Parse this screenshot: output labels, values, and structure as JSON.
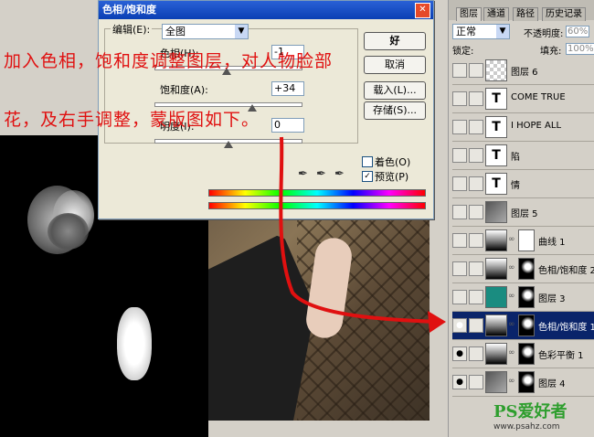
{
  "dialog": {
    "title": "色相/饱和度",
    "edit_label": "编辑(E):",
    "edit_value": "全图",
    "hue_label": "色相(H):",
    "hue_value": "-1",
    "saturation_label": "饱和度(A):",
    "saturation_value": "+34",
    "lightness_label": "明度(I):",
    "lightness_value": "0",
    "btn_ok": "好",
    "btn_cancel": "取消",
    "btn_load": "载入(L)...",
    "btn_save": "存储(S)...",
    "colorize_label": "着色(O)",
    "colorize_checked": false,
    "preview_label": "预览(P)",
    "preview_checked": true,
    "close_glyph": "✕"
  },
  "overlay": {
    "line1": "加入色相，饱和度调整图层，对人物脸部",
    "line2": "花，及右手调整，蒙版图如下。"
  },
  "panel": {
    "tabs": [
      "图层",
      "通道",
      "路径",
      "历史记录"
    ],
    "blend_mode": "正常",
    "opacity_label": "不透明度:",
    "opacity_value": "60%",
    "lock_label": "锁定:",
    "fill_label": "填充:",
    "fill_value": "100%",
    "layers": [
      {
        "name": "图层 6",
        "type": "pixel",
        "visible": false
      },
      {
        "name": "COME TRUE",
        "type": "text",
        "visible": false
      },
      {
        "name": "I HOPE ALL",
        "type": "text",
        "visible": false
      },
      {
        "name": "陷",
        "type": "text",
        "visible": false
      },
      {
        "name": "情",
        "type": "text",
        "visible": false
      },
      {
        "name": "图层 5",
        "type": "pixel",
        "visible": false
      },
      {
        "name": "曲线 1",
        "type": "adjust",
        "visible": false
      },
      {
        "name": "色相/饱和度 2",
        "type": "adjust",
        "visible": false
      },
      {
        "name": "图层 3",
        "type": "pixel",
        "visible": false
      },
      {
        "name": "色相/饱和度 1",
        "type": "adjust",
        "visible": true,
        "selected": true
      },
      {
        "name": "色彩平衡 1",
        "type": "adjust",
        "visible": true
      },
      {
        "name": "图层 4",
        "type": "pixel",
        "visible": true
      }
    ],
    "text_thumb_glyph": "T",
    "eye_glyph": "👁"
  },
  "watermark": {
    "logo": "PS爱好者",
    "url": "www.psahz.com"
  },
  "colors": {
    "accent_red": "#e01010",
    "title_blue": "#0a3fb4",
    "selected_layer": "#0a246a",
    "teal_layer": "#1a8c80"
  }
}
